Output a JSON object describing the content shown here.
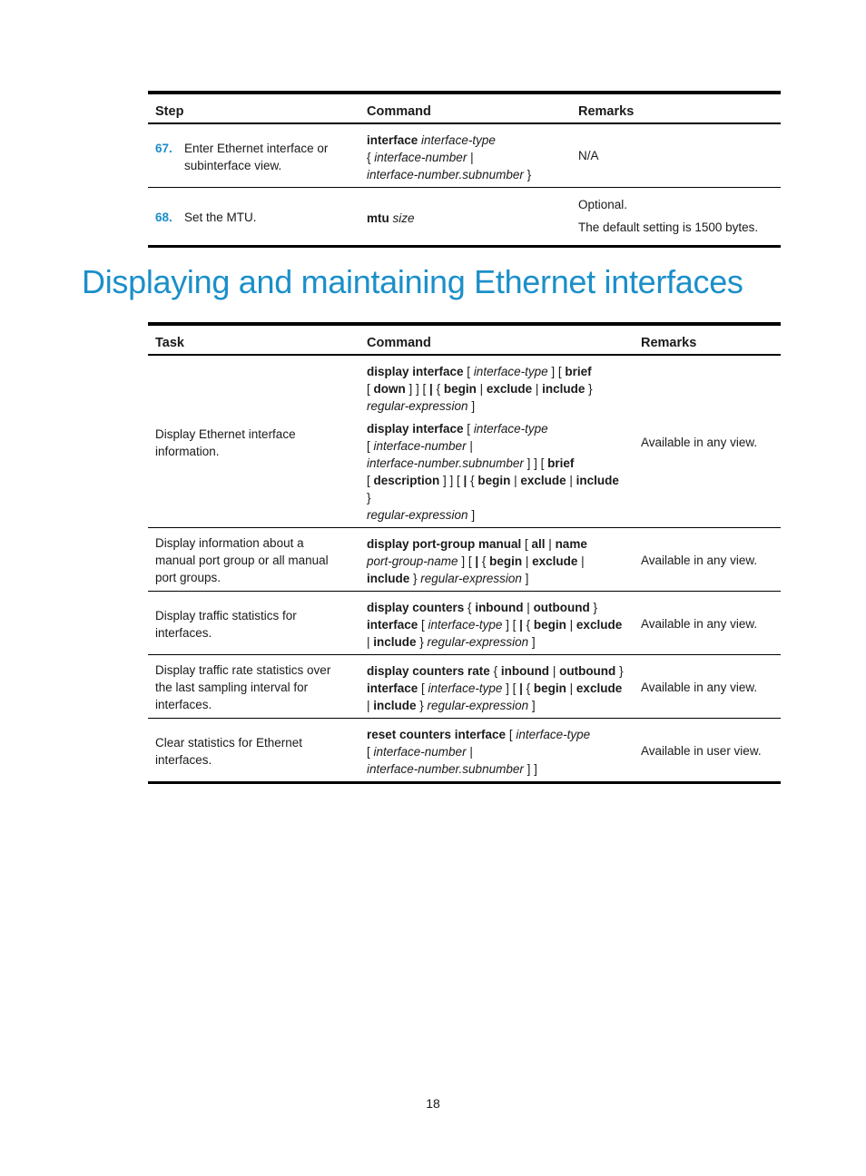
{
  "config_table": {
    "headers": {
      "step": "Step",
      "command": "Command",
      "remarks": "Remarks"
    },
    "rows": [
      {
        "step_number": "67.",
        "step_text": [
          "Enter Ethernet interface or",
          "subinterface view."
        ],
        "command": [
          [
            [
              [
                "b",
                "interface"
              ],
              [
                "t",
                " "
              ],
              [
                "i",
                "interface-type"
              ]
            ],
            [
              [
                "t",
                "{ "
              ],
              [
                "i",
                "interface-number"
              ],
              [
                "t",
                " |"
              ]
            ],
            [
              [
                "i",
                "interface-number.subnumber"
              ],
              [
                "t",
                " }"
              ]
            ]
          ]
        ],
        "remarks": [
          "N/A"
        ]
      },
      {
        "step_number": "68.",
        "step_text": [
          "Set the MTU."
        ],
        "command": [
          [
            [
              [
                "b",
                "mtu"
              ],
              [
                "t",
                " "
              ],
              [
                "i",
                "size"
              ]
            ]
          ]
        ],
        "remarks": [
          "Optional.",
          "The default setting is 1500 bytes."
        ]
      }
    ]
  },
  "section_title": "Displaying and maintaining Ethernet interfaces",
  "display_table": {
    "headers": {
      "task": "Task",
      "command": "Command",
      "remarks": "Remarks"
    },
    "rows": [
      {
        "task": [
          "Display Ethernet interface",
          "information."
        ],
        "command": [
          [
            [
              [
                "b",
                "display interface"
              ],
              [
                "t",
                " [ "
              ],
              [
                "i",
                "interface-type"
              ],
              [
                "t",
                " ] [ "
              ],
              [
                "b",
                "brief"
              ]
            ],
            [
              [
                "t",
                "[ "
              ],
              [
                "b",
                "down"
              ],
              [
                "t",
                " ] ] [ "
              ],
              [
                "b",
                "|"
              ],
              [
                "t",
                " { "
              ],
              [
                "b",
                "begin"
              ],
              [
                "t",
                " | "
              ],
              [
                "b",
                "exclude"
              ],
              [
                "t",
                " | "
              ],
              [
                "b",
                "include"
              ],
              [
                "t",
                " }"
              ]
            ],
            [
              [
                "i",
                "regular-expression"
              ],
              [
                "t",
                " ]"
              ]
            ]
          ],
          [
            [
              [
                "b",
                "display interface"
              ],
              [
                "t",
                " [ "
              ],
              [
                "i",
                "interface-type"
              ]
            ],
            [
              [
                "t",
                "[ "
              ],
              [
                "i",
                "interface-number"
              ],
              [
                "t",
                " |"
              ]
            ],
            [
              [
                "i",
                "interface-number.subnumber"
              ],
              [
                "t",
                " ] ] [ "
              ],
              [
                "b",
                "brief"
              ]
            ],
            [
              [
                "t",
                "[ "
              ],
              [
                "b",
                "description"
              ],
              [
                "t",
                " ] ] [ "
              ],
              [
                "b",
                "|"
              ],
              [
                "t",
                " { "
              ],
              [
                "b",
                "begin"
              ],
              [
                "t",
                " | "
              ],
              [
                "b",
                "exclude"
              ],
              [
                "t",
                " | "
              ],
              [
                "b",
                "include"
              ],
              [
                "t",
                " }"
              ]
            ],
            [
              [
                "i",
                "regular-expression"
              ],
              [
                "t",
                " ]"
              ]
            ]
          ]
        ],
        "remarks": "Available in any view."
      },
      {
        "task": [
          "Display information about a",
          "manual port group or all manual",
          "port groups."
        ],
        "command": [
          [
            [
              [
                "b",
                "display port-group manual"
              ],
              [
                "t",
                " [ "
              ],
              [
                "b",
                "all"
              ],
              [
                "t",
                " | "
              ],
              [
                "b",
                "name"
              ]
            ],
            [
              [
                "i",
                "port-group-name"
              ],
              [
                "t",
                " ] [ "
              ],
              [
                "b",
                "|"
              ],
              [
                "t",
                " { "
              ],
              [
                "b",
                "begin"
              ],
              [
                "t",
                " | "
              ],
              [
                "b",
                "exclude"
              ],
              [
                "t",
                " |"
              ]
            ],
            [
              [
                "b",
                "include"
              ],
              [
                "t",
                " } "
              ],
              [
                "i",
                "regular-expression"
              ],
              [
                "t",
                " ]"
              ]
            ]
          ]
        ],
        "remarks": "Available in any view."
      },
      {
        "task": [
          "Display traffic statistics for",
          "interfaces."
        ],
        "command": [
          [
            [
              [
                "b",
                "display counters"
              ],
              [
                "t",
                " { "
              ],
              [
                "b",
                "inbound"
              ],
              [
                "t",
                " | "
              ],
              [
                "b",
                "outbound"
              ],
              [
                "t",
                " }"
              ]
            ],
            [
              [
                "b",
                "interface"
              ],
              [
                "t",
                " [ "
              ],
              [
                "i",
                "interface-type"
              ],
              [
                "t",
                " ] [ "
              ],
              [
                "b",
                "|"
              ],
              [
                "t",
                " { "
              ],
              [
                "b",
                "begin"
              ],
              [
                "t",
                " | "
              ],
              [
                "b",
                "exclude"
              ]
            ],
            [
              [
                "t",
                "| "
              ],
              [
                "b",
                "include"
              ],
              [
                "t",
                " } "
              ],
              [
                "i",
                "regular-expression"
              ],
              [
                "t",
                " ]"
              ]
            ]
          ]
        ],
        "remarks": "Available in any view."
      },
      {
        "task": [
          "Display traffic rate statistics over",
          "the last sampling interval for",
          "interfaces."
        ],
        "command": [
          [
            [
              [
                "b",
                "display counters rate"
              ],
              [
                "t",
                " { "
              ],
              [
                "b",
                "inbound"
              ],
              [
                "t",
                " | "
              ],
              [
                "b",
                "outbound"
              ],
              [
                "t",
                " }"
              ]
            ],
            [
              [
                "b",
                "interface"
              ],
              [
                "t",
                " [ "
              ],
              [
                "i",
                "interface-type"
              ],
              [
                "t",
                " ] [ "
              ],
              [
                "b",
                "|"
              ],
              [
                "t",
                " { "
              ],
              [
                "b",
                "begin"
              ],
              [
                "t",
                " | "
              ],
              [
                "b",
                "exclude"
              ]
            ],
            [
              [
                "t",
                "| "
              ],
              [
                "b",
                "include"
              ],
              [
                "t",
                " } "
              ],
              [
                "i",
                "regular-expression"
              ],
              [
                "t",
                " ]"
              ]
            ]
          ]
        ],
        "remarks": "Available in any view."
      },
      {
        "task": [
          "Clear statistics for Ethernet",
          "interfaces."
        ],
        "command": [
          [
            [
              [
                "b",
                "reset counters interface"
              ],
              [
                "t",
                " [ "
              ],
              [
                "i",
                "interface-type"
              ]
            ],
            [
              [
                "t",
                "[ "
              ],
              [
                "i",
                "interface-number"
              ],
              [
                "t",
                " |"
              ]
            ],
            [
              [
                "i",
                "interface-number.subnumber"
              ],
              [
                "t",
                " ] ]"
              ]
            ]
          ]
        ],
        "remarks": "Available in user view."
      }
    ]
  },
  "page_number": "18",
  "colors": {
    "accent": "#1b8fc9",
    "text": "#1a1a1a",
    "rule": "#000000"
  }
}
